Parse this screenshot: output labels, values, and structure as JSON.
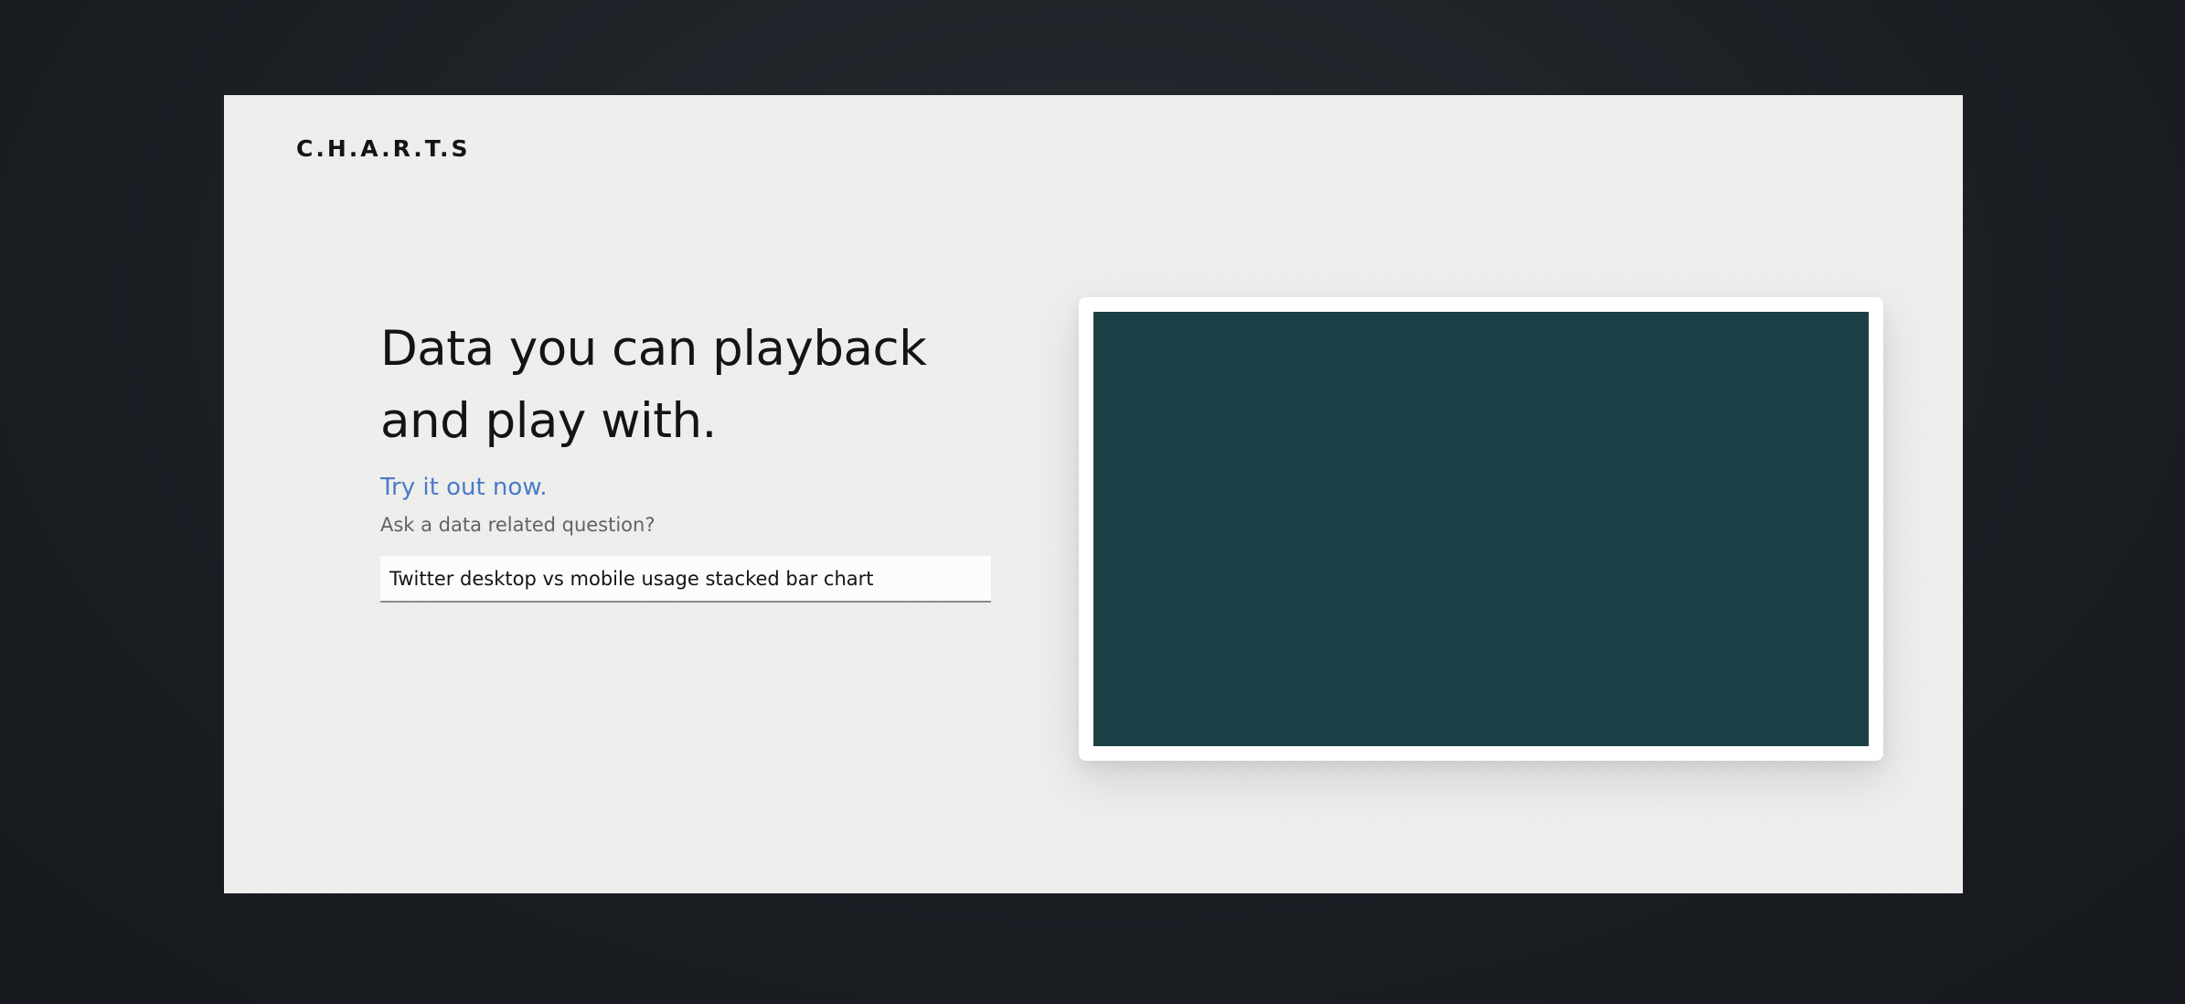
{
  "brand": {
    "logo": "C.H.A.R.T.S"
  },
  "hero": {
    "headline_line1": "Data you can playback",
    "headline_line2": "and play with.",
    "cta": "Try it out now.",
    "question_label": "Ask a data related question?"
  },
  "query": {
    "value": "Twitter desktop vs mobile usage stacked bar chart "
  },
  "preview": {
    "canvas_color": "#1b4045"
  },
  "colors": {
    "accent": "#4a7bc8",
    "background": "#1b1f24",
    "card": "#efefed"
  }
}
